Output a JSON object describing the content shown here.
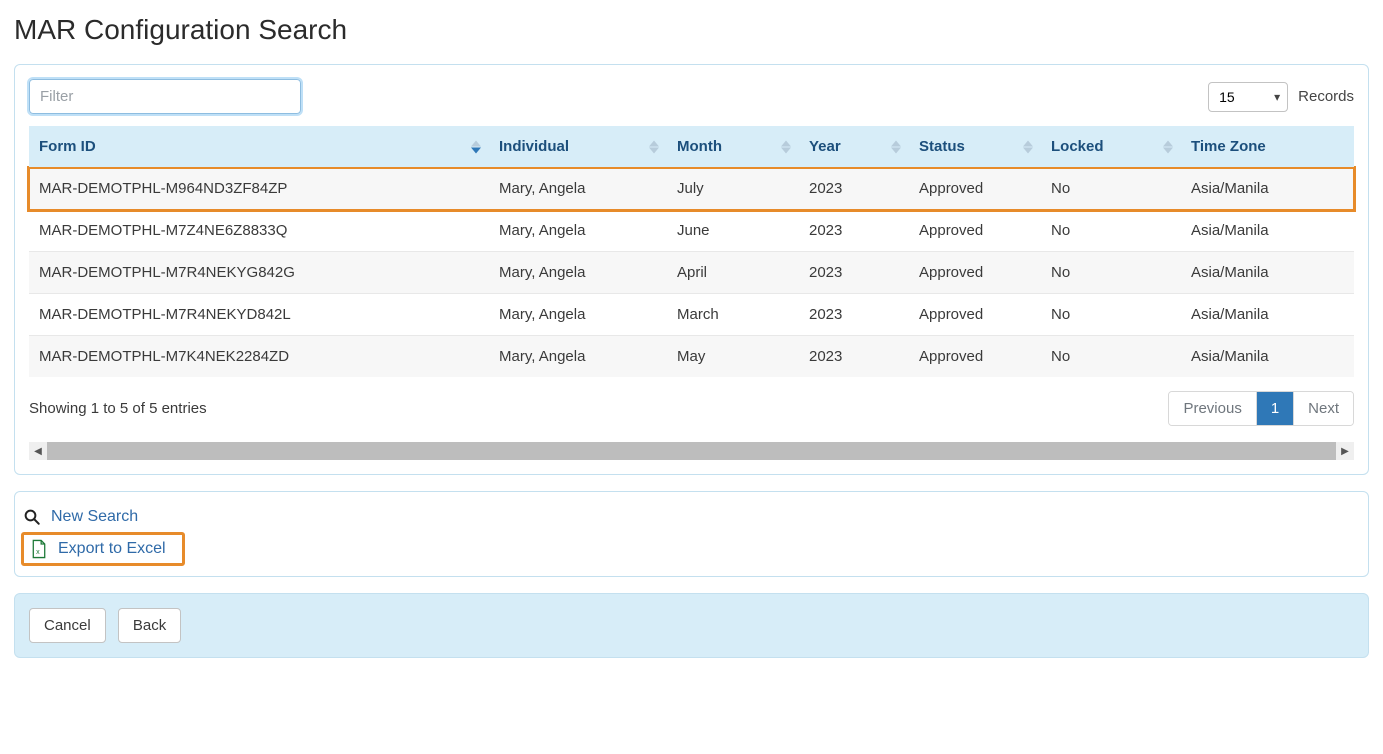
{
  "page": {
    "title": "MAR Configuration Search"
  },
  "filter": {
    "placeholder": "Filter",
    "value": ""
  },
  "records": {
    "value": "15",
    "label": "Records"
  },
  "columns": [
    {
      "label": "Form ID",
      "sorted": "desc"
    },
    {
      "label": "Individual",
      "sorted": "none"
    },
    {
      "label": "Month",
      "sorted": "none"
    },
    {
      "label": "Year",
      "sorted": "none"
    },
    {
      "label": "Status",
      "sorted": "none"
    },
    {
      "label": "Locked",
      "sorted": "none"
    },
    {
      "label": "Time Zone",
      "sorted": "nosort"
    }
  ],
  "rows": [
    {
      "form_id": "MAR-DEMOTPHL-M964ND3ZF84ZP",
      "individual": "Mary, Angela",
      "month": "July",
      "year": "2023",
      "status": "Approved",
      "locked": "No",
      "tz": "Asia/Manila",
      "highlight": true
    },
    {
      "form_id": "MAR-DEMOTPHL-M7Z4NE6Z8833Q",
      "individual": "Mary, Angela",
      "month": "June",
      "year": "2023",
      "status": "Approved",
      "locked": "No",
      "tz": "Asia/Manila",
      "highlight": false
    },
    {
      "form_id": "MAR-DEMOTPHL-M7R4NEKYG842G",
      "individual": "Mary, Angela",
      "month": "April",
      "year": "2023",
      "status": "Approved",
      "locked": "No",
      "tz": "Asia/Manila",
      "highlight": false
    },
    {
      "form_id": "MAR-DEMOTPHL-M7R4NEKYD842L",
      "individual": "Mary, Angela",
      "month": "March",
      "year": "2023",
      "status": "Approved",
      "locked": "No",
      "tz": "Asia/Manila",
      "highlight": false
    },
    {
      "form_id": "MAR-DEMOTPHL-M7K4NEK2284ZD",
      "individual": "Mary, Angela",
      "month": "May",
      "year": "2023",
      "status": "Approved",
      "locked": "No",
      "tz": "Asia/Manila",
      "highlight": false
    }
  ],
  "entries_text": "Showing 1 to 5 of 5 entries",
  "pager": {
    "prev": "Previous",
    "pages": [
      "1"
    ],
    "active": "1",
    "next": "Next"
  },
  "actions": {
    "new_search": "New Search",
    "export": "Export to Excel"
  },
  "buttons": {
    "cancel": "Cancel",
    "back": "Back"
  }
}
